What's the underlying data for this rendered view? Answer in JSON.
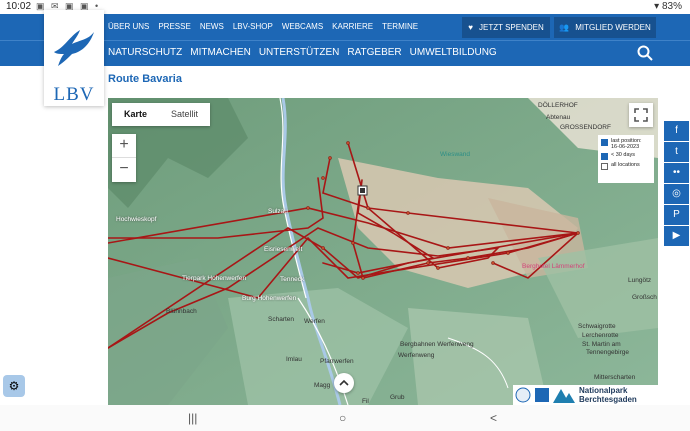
{
  "statusbar": {
    "time": "10:02",
    "battery": "83%",
    "icons": "▣ ✉ ▣ ▣ •"
  },
  "topnav": {
    "links": [
      "ÜBER UNS",
      "PRESSE",
      "NEWS",
      "LBV-SHOP",
      "WEBCAMS",
      "KARRIERE",
      "TERMINE"
    ]
  },
  "actions": {
    "donate": "JETZT SPENDEN",
    "member": "MITGLIED WERDEN"
  },
  "mainnav": {
    "items": [
      "NATURSCHUTZ",
      "MITMACHEN",
      "UNTERSTÜTZEN",
      "RATGEBER",
      "UMWELTBILDUNG"
    ]
  },
  "logo": {
    "text": "LBV"
  },
  "page": {
    "title": "Route Bavaria"
  },
  "map": {
    "tabs": {
      "map": "Karte",
      "satellite": "Satellit"
    },
    "zoom": {
      "in": "+",
      "out": "−"
    },
    "legend": {
      "last_position": "last position: 16-06-2023",
      "days": "< 30 days",
      "all_locations": "all locations"
    },
    "labels": {
      "dollerhof": "DÖLLERHOF",
      "abtenau": "Abtenau",
      "grossendorf": "GROSSENDORF",
      "wieswand": "Wieswand",
      "hochwieskopf": "Hochwieskopf",
      "sulzau": "Sulzau",
      "eisriesenwelt": "Eisriesenwelt",
      "tierpark": "Tierpark Hohenwerfen",
      "tenneck": "Tenneck",
      "burg": "Burg Hohenwerfen",
      "berghotel": "Berghotel Lämmerhof",
      "lungotz": "Lungötz",
      "grossch": "Großsch",
      "bluhnbach": "Blühnbach",
      "scharten": "Scharten",
      "werfen": "Werfen",
      "schwaig": "Schwaigrotte",
      "lerchen": "Lerchenrotte",
      "st_martin": "St. Martin am",
      "tennengebirge": "Tennengebirge",
      "bergbahnen": "Bergbahnen Werfenweng",
      "werfenweng": "Werfenweng",
      "imlau": "Imlau",
      "pfarrwerfen": "Pfarrwerfen",
      "maggi": "Magg",
      "mitterscharten": "Mitterscharten",
      "grub": "Grub",
      "fil": "Fil"
    },
    "np_logo": {
      "line1": "Nationalpark",
      "line2": "Berchtesgaden"
    },
    "route_color": "#a81616"
  },
  "social": [
    "f",
    "t",
    "••",
    "◎",
    "P",
    "▶"
  ],
  "cookie": "⚙",
  "bottom": {
    "recents": "|||",
    "home": "○",
    "back": "<"
  }
}
